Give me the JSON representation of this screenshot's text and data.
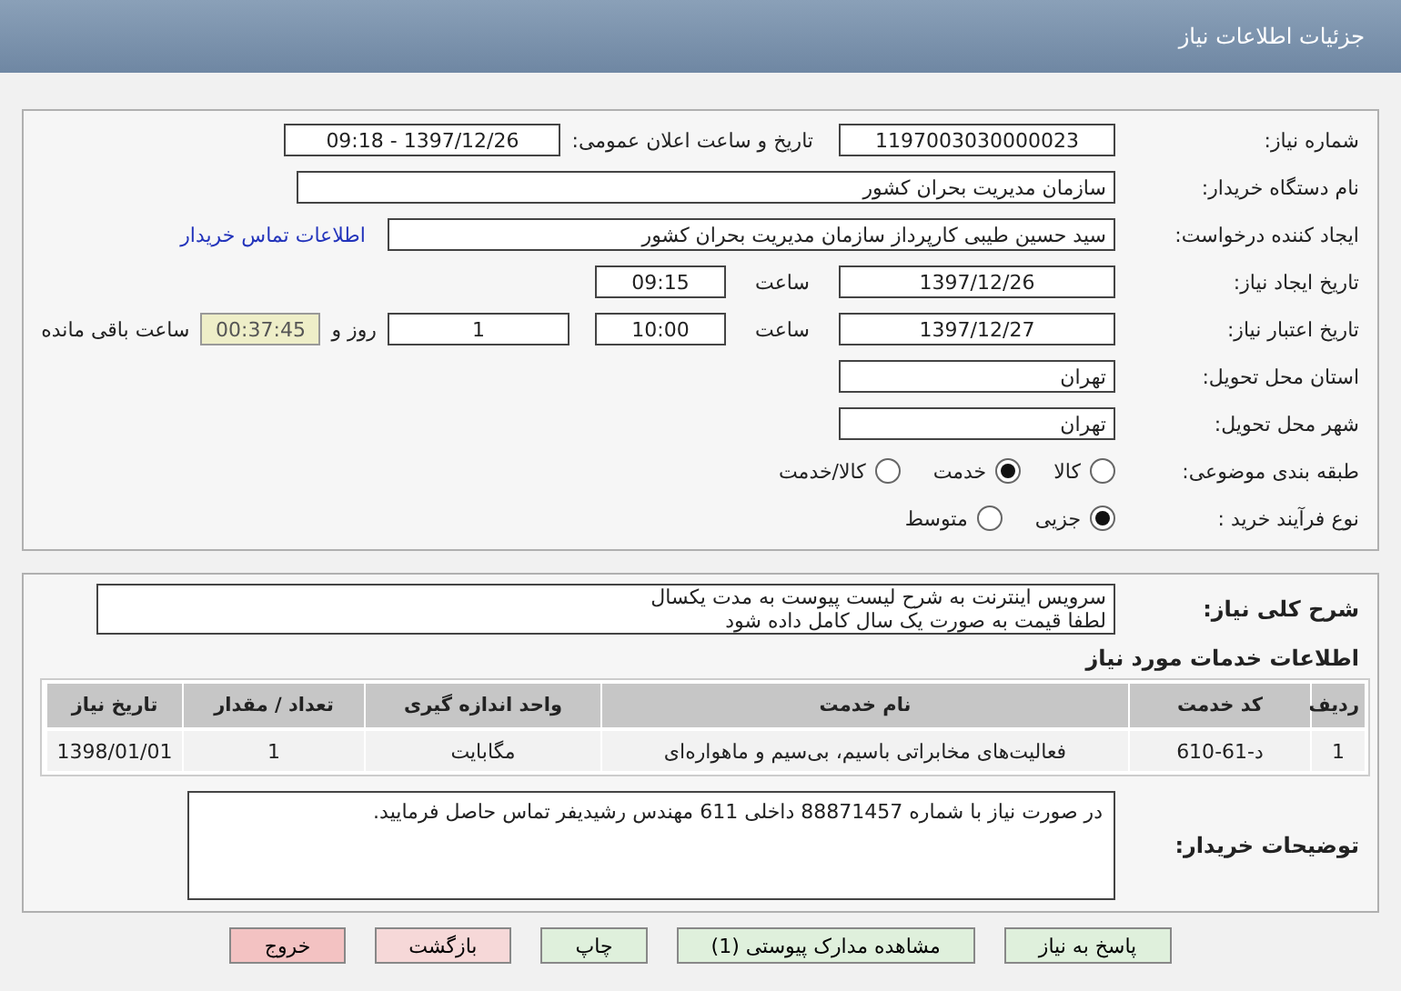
{
  "header": {
    "title": "جزئیات اطلاعات نیاز"
  },
  "need_number": {
    "label": "شماره نیاز:",
    "value": "1197003030000023"
  },
  "announce": {
    "label": "تاریخ و ساعت اعلان عمومی:",
    "value": "1397/12/26 - 09:18"
  },
  "buyer_org": {
    "label": "نام دستگاه خریدار:",
    "value": "سازمان مدیریت بحران کشور"
  },
  "requester": {
    "label": "ایجاد کننده درخواست:",
    "value": "سید حسین طیبی کارپرداز سازمان مدیریت بحران کشور",
    "contact_link": "اطلاعات تماس خریدار"
  },
  "created": {
    "label": "تاریخ ایجاد نیاز:",
    "date": "1397/12/26",
    "time_label": "ساعت",
    "time": "09:15"
  },
  "validity": {
    "label": "تاریخ اعتبار نیاز:",
    "date": "1397/12/27",
    "time_label": "ساعت",
    "time": "10:00",
    "days": "1",
    "days_label": "روز و",
    "remaining": "00:37:45",
    "remaining_label": "ساعت باقی مانده"
  },
  "province": {
    "label": "استان محل تحویل:",
    "value": "تهران"
  },
  "city": {
    "label": "شهر محل تحویل:",
    "value": "تهران"
  },
  "category": {
    "label": "طبقه بندی موضوعی:",
    "options": [
      {
        "label": "کالا",
        "selected": false
      },
      {
        "label": "خدمت",
        "selected": true
      },
      {
        "label": "کالا/خدمت",
        "selected": false
      }
    ]
  },
  "process": {
    "label": "نوع فرآیند خرید :",
    "options": [
      {
        "label": "جزیی",
        "selected": true
      },
      {
        "label": "متوسط",
        "selected": false
      }
    ]
  },
  "description": {
    "label": "شرح کلی نیاز:",
    "lines": [
      "سرویس اینترنت به شرح لیست پیوست به مدت یکسال",
      "لطفا قیمت به صورت یک سال کامل داده شود"
    ]
  },
  "services": {
    "title": "اطلاعات خدمات مورد نیاز",
    "columns": [
      "ردیف",
      "کد خدمت",
      "نام خدمت",
      "واحد اندازه گیری",
      "تعداد / مقدار",
      "تاریخ نیاز"
    ],
    "rows": [
      [
        "1",
        "د-61-610",
        "فعالیت‌های مخابراتی باسیم، بی‌سیم و ماهواره‌ای",
        "مگابایت",
        "1",
        "1398/01/01"
      ]
    ]
  },
  "buyer_notes": {
    "label": "توضیحات خریدار:",
    "text": "در صورت نیاز با شماره 88871457 داخلی 611 مهندس رشیدیفر تماس حاصل فرمایید."
  },
  "buttons": [
    {
      "label": "پاسخ به نیاز",
      "kind": "normal"
    },
    {
      "label": "مشاهده مدارک پیوستی (1)",
      "kind": "normal"
    },
    {
      "label": "چاپ",
      "kind": "normal"
    },
    {
      "label": "بازگشت",
      "kind": "warn"
    },
    {
      "label": "خروج",
      "kind": "danger"
    }
  ]
}
